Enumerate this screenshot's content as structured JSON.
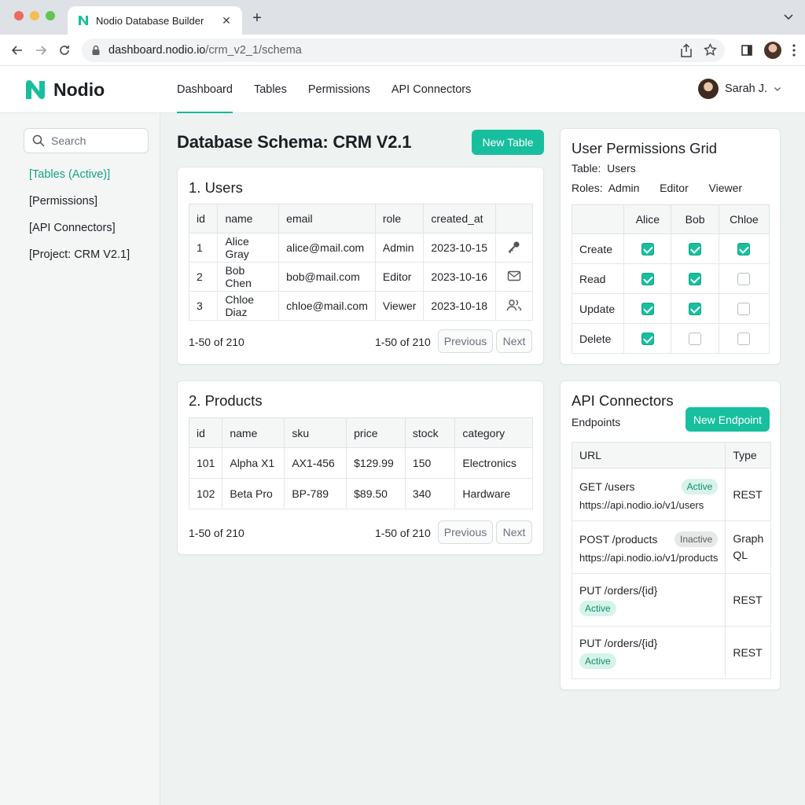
{
  "browser": {
    "tab_title": "Nodio Database Builder",
    "url_host": "dashboard.nodio.io",
    "url_path": "/crm_v2_1/schema"
  },
  "app": {
    "logo_text": "Nodio",
    "brand_color": "#17bf9e",
    "nav": [
      "Dashboard",
      "Tables",
      "Permissions",
      "API Connectors"
    ],
    "active_nav": "Dashboard",
    "user_name": "Sarah J."
  },
  "sidebar": {
    "search_placeholder": "Search",
    "items": [
      "[Tables (Active)]",
      "[Permissions]",
      "[API Connectors]",
      "[Project: CRM V2.1]"
    ]
  },
  "main": {
    "title": "Database Schema: CRM V2.1",
    "new_table_label": "New Table"
  },
  "users_table": {
    "title": "1. Users",
    "columns": [
      "id",
      "name",
      "email",
      "role",
      "created_at",
      ""
    ],
    "rows": [
      {
        "id": "1",
        "name": "Alice Gray",
        "email": "alice@mail.com",
        "role": "Admin",
        "created_at": "2023-10-15",
        "icon": "key-icon"
      },
      {
        "id": "2",
        "name": "Bob Chen",
        "email": "bob@mail.com",
        "role": "Editor",
        "created_at": "2023-10-16",
        "icon": "mail-icon"
      },
      {
        "id": "3",
        "name": "Chloe Diaz",
        "email": "chloe@mail.com",
        "role": "Viewer",
        "created_at": "2023-10-18",
        "icon": "users-icon"
      }
    ],
    "pager_left": "1-50 of 210",
    "pager_count": "1-50 of 210",
    "prev_label": "Previous",
    "next_label": "Next"
  },
  "products_table": {
    "title": "2. Products",
    "columns": [
      "id",
      "name",
      "sku",
      "price",
      "stock",
      "category"
    ],
    "rows": [
      {
        "id": "101",
        "name": "Alpha X1",
        "sku": "AX1-456",
        "price": "$129.99",
        "stock": "150",
        "category": "Electronics"
      },
      {
        "id": "102",
        "name": "Beta Pro",
        "sku": "BP-789",
        "price": "$89.50",
        "stock": "340",
        "category": "Hardware"
      }
    ],
    "pager_left": "1-50 of 210",
    "pager_count": "1-50 of 210",
    "prev_label": "Previous",
    "next_label": "Next"
  },
  "permissions": {
    "title": "User Permissions Grid",
    "table_label": "Table:",
    "table_value": "Users",
    "roles_label": "Roles:",
    "roles": [
      "Admin",
      "Editor",
      "Viewer"
    ],
    "users": [
      "Alice",
      "Bob",
      "Chloe"
    ],
    "rows": [
      {
        "action": "Create",
        "checks": [
          true,
          true,
          true
        ]
      },
      {
        "action": "Read",
        "checks": [
          true,
          true,
          false
        ]
      },
      {
        "action": "Update",
        "checks": [
          true,
          true,
          false
        ]
      },
      {
        "action": "Delete",
        "checks": [
          true,
          false,
          false
        ]
      }
    ]
  },
  "api": {
    "title": "API Connectors",
    "subtitle": "Endpoints",
    "new_endpoint_label": "New Endpoint",
    "col_url": "URL",
    "col_type": "Type",
    "rows": [
      {
        "method_path": "GET /users",
        "status": "Active",
        "endpoint": "https://api.nodio.io/v1/users",
        "type": "REST"
      },
      {
        "method_path": "POST /products",
        "status": "Inactive",
        "endpoint": "https://api.nodio.io/v1/products",
        "type": "Graph QL"
      },
      {
        "method_path": "PUT /orders/{id}",
        "status": "Active",
        "endpoint": "",
        "type": "REST"
      },
      {
        "method_path": "PUT /orders/{id}",
        "status": "Active",
        "endpoint": "",
        "type": "REST"
      }
    ]
  }
}
